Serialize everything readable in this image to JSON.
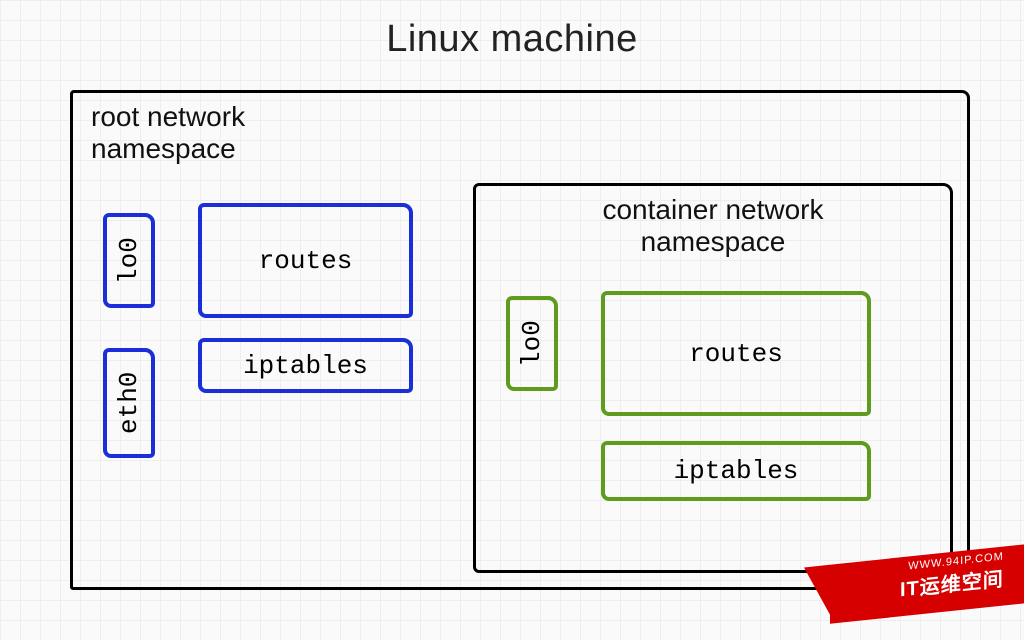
{
  "title": "Linux machine",
  "root_ns": {
    "label": "root network\nnamespace",
    "lo": "lo0",
    "eth": "eth0",
    "routes": "routes",
    "iptables": "iptables"
  },
  "container_ns": {
    "label": "container network\nnamespace",
    "lo": "lo0",
    "routes": "routes",
    "iptables": "iptables"
  },
  "watermark": {
    "url": "WWW.94IP.COM",
    "brand": "IT运维空间"
  }
}
